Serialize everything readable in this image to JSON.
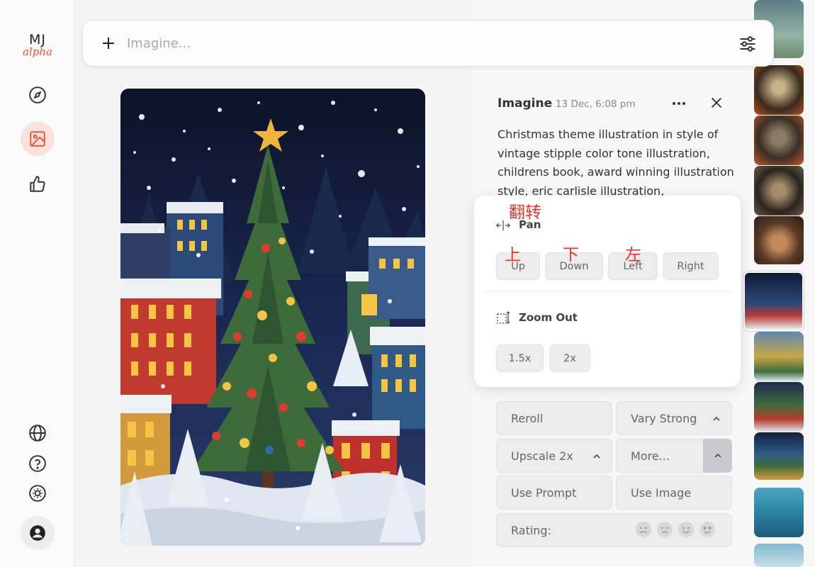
{
  "sidebar": {
    "logo_top": "MJ",
    "logo_bottom": "alpha",
    "nav": [
      {
        "icon": "compass-icon",
        "label": "explore"
      },
      {
        "icon": "image-icon",
        "label": "create",
        "active": true
      },
      {
        "icon": "thumbs-up-icon",
        "label": "rate"
      }
    ],
    "bottom": [
      {
        "icon": "globe-icon"
      },
      {
        "icon": "help-icon"
      },
      {
        "icon": "sun-icon"
      },
      {
        "icon": "user-icon"
      }
    ],
    "accent_color": "#e8543a"
  },
  "prompt": {
    "placeholder": "Imagine..."
  },
  "detail": {
    "title": "Imagine",
    "date": "13 Dec, 6:08 pm",
    "prompt_text": "Christmas theme illustration in style of vintage stipple color tone illustration, childrens book, award winning illustration style, eric carlisle illustration,"
  },
  "popup": {
    "annotation_title": "翻转",
    "pan_label": "Pan",
    "pan_buttons": [
      "Up",
      "Down",
      "Left",
      "Right"
    ],
    "pan_annotations": [
      "上",
      "下",
      "左"
    ],
    "zoom_label": "Zoom Out",
    "zoom_buttons": [
      "1.5x",
      "2x"
    ],
    "annotation_color": "#e8332a"
  },
  "actions": {
    "reroll": "Reroll",
    "vary_strong": "Vary Strong",
    "upscale": "Upscale 2x",
    "more": "More...",
    "use_prompt": "Use Prompt",
    "use_image": "Use Image",
    "rating": "Rating:"
  }
}
